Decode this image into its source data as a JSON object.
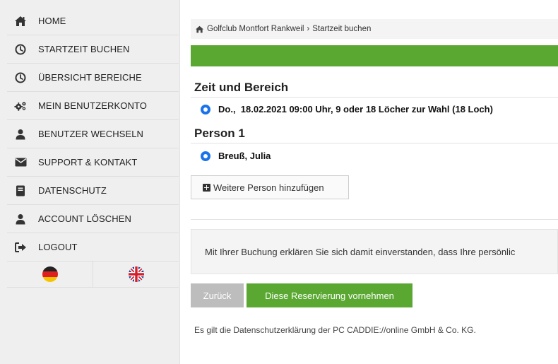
{
  "sidebar": {
    "items": [
      {
        "label": "HOME",
        "icon": "home-icon"
      },
      {
        "label": "STARTZEIT BUCHEN",
        "icon": "clock-icon"
      },
      {
        "label": "ÜBERSICHT BEREICHE",
        "icon": "clock-icon"
      },
      {
        "label": "MEIN BENUTZERKONTO",
        "icon": "gears-icon"
      },
      {
        "label": "BENUTZER WECHSELN",
        "icon": "user-icon"
      },
      {
        "label": "SUPPORT & KONTAKT",
        "icon": "envelope-icon"
      },
      {
        "label": "DATENSCHUTZ",
        "icon": "book-icon"
      },
      {
        "label": "ACCOUNT LÖSCHEN",
        "icon": "user-icon"
      },
      {
        "label": "LOGOUT",
        "icon": "sign-out-icon"
      }
    ],
    "languages": [
      "de-flag-icon",
      "uk-flag-icon"
    ]
  },
  "breadcrumb": {
    "club": "Golfclub Montfort Rankweil",
    "separator": "›",
    "page": "Startzeit buchen"
  },
  "sections": {
    "time_title": "Zeit und Bereich",
    "time_option": "Do.,  18.02.2021 09:00 Uhr, 9 oder 18 Löcher zur Wahl (18 Loch)",
    "person_title": "Person 1",
    "person_option": "Breuß, Julia"
  },
  "add_person_label": "Weitere Person hinzufügen",
  "consent_text": "Mit Ihrer Buchung erklären Sie sich damit einverstanden, dass Ihre persönlic",
  "buttons": {
    "back": "Zurück",
    "reserve": "Diese Reservierung vornehmen"
  },
  "footer_note": "Es gilt die Datenschutzerklärung der PC CADDIE://online GmbH & Co. KG.",
  "colors": {
    "accent_green": "#5aa832",
    "back_gray": "#bdbdbd",
    "radio_blue": "#1a73e8"
  }
}
